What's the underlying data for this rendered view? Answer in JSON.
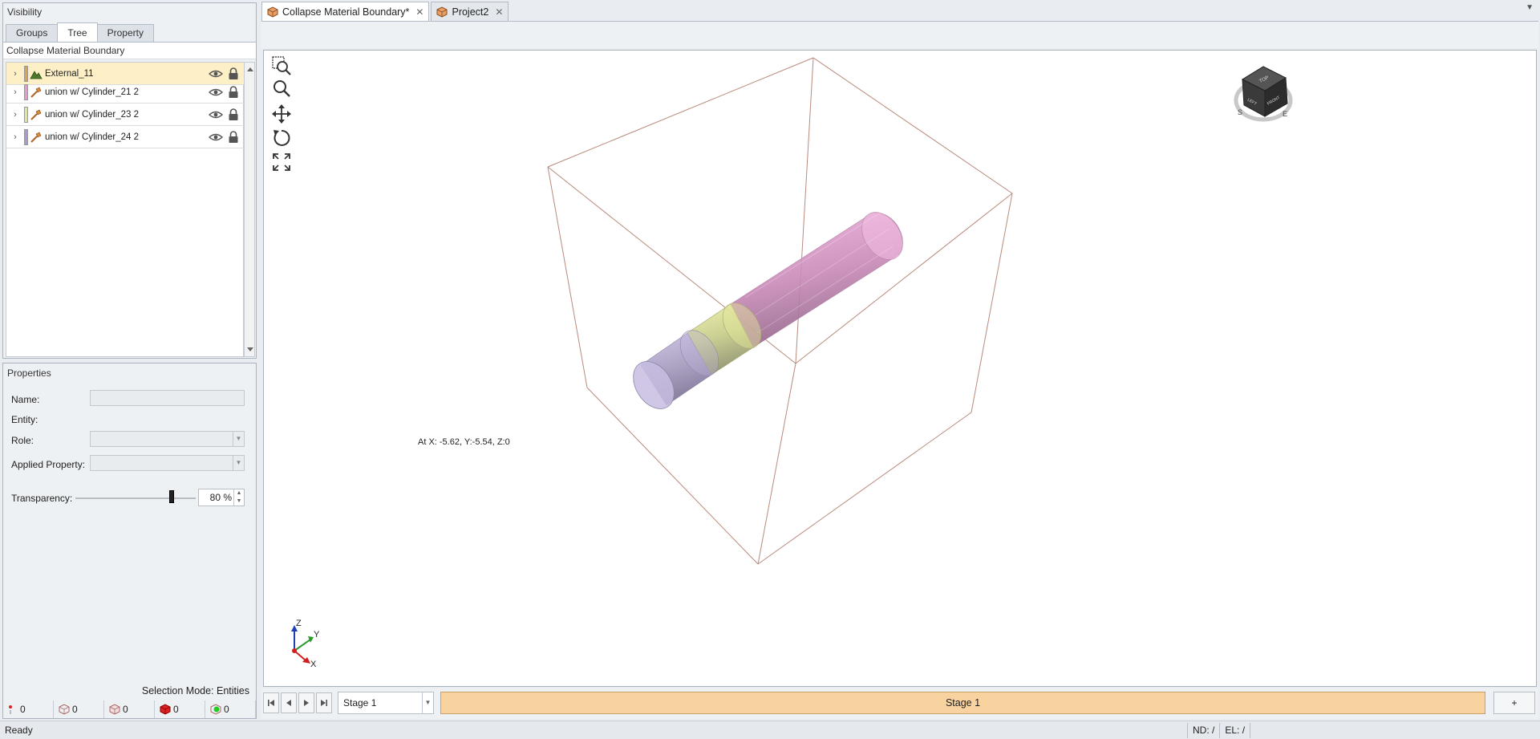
{
  "visibility": {
    "title": "Visibility",
    "tabs": [
      {
        "label": "Groups"
      },
      {
        "label": "Tree",
        "active": true
      },
      {
        "label": "Property"
      }
    ],
    "tree_header": "Collapse Material Boundary",
    "items": [
      {
        "label": "External_11",
        "color": "#d8a64a",
        "selected": true
      },
      {
        "label": "union w/ Cylinder_21 2",
        "color": "#e89ad0"
      },
      {
        "label": "union w/ Cylinder_23 2",
        "color": "#dfe69a"
      },
      {
        "label": "union w/ Cylinder_24 2",
        "color": "#a89ad0"
      }
    ]
  },
  "properties": {
    "title": "Properties",
    "name_label": "Name:",
    "entity_label": "Entity:",
    "role_label": "Role:",
    "applied_property_label": "Applied Property:",
    "transparency_label": "Transparency:",
    "transparency_value": "80 %",
    "transparency_level": 0.8,
    "selection_mode": "Selection Mode: Entities",
    "counts": [
      "0",
      "0",
      "0",
      "0",
      "0"
    ]
  },
  "document": {
    "tabs": [
      {
        "label": "Collapse Material Boundary*",
        "active": true
      },
      {
        "label": "Project2"
      }
    ],
    "coordinate_readout": "At X: -5.62, Y:-5.54, Z:0",
    "axis_labels": {
      "z": "Z",
      "y": "Y",
      "x": "X"
    },
    "nav_cube": {
      "top": "TOP",
      "front": "FRONT",
      "left": "LEFT",
      "s": "S",
      "e": "E"
    },
    "stage_select": "Stage 1",
    "stage_strip": "Stage 1",
    "stage_add": "+"
  },
  "status": {
    "text": "Ready",
    "nd": "ND: /",
    "el": "EL: /"
  },
  "colors": {
    "accent_stage": "#f8d3a0",
    "cylinder_pink": "#e9a3d8",
    "cylinder_yellow": "#dfe69a",
    "cylinder_purple": "#b7acd8",
    "box_edge": "#b98a7c"
  }
}
